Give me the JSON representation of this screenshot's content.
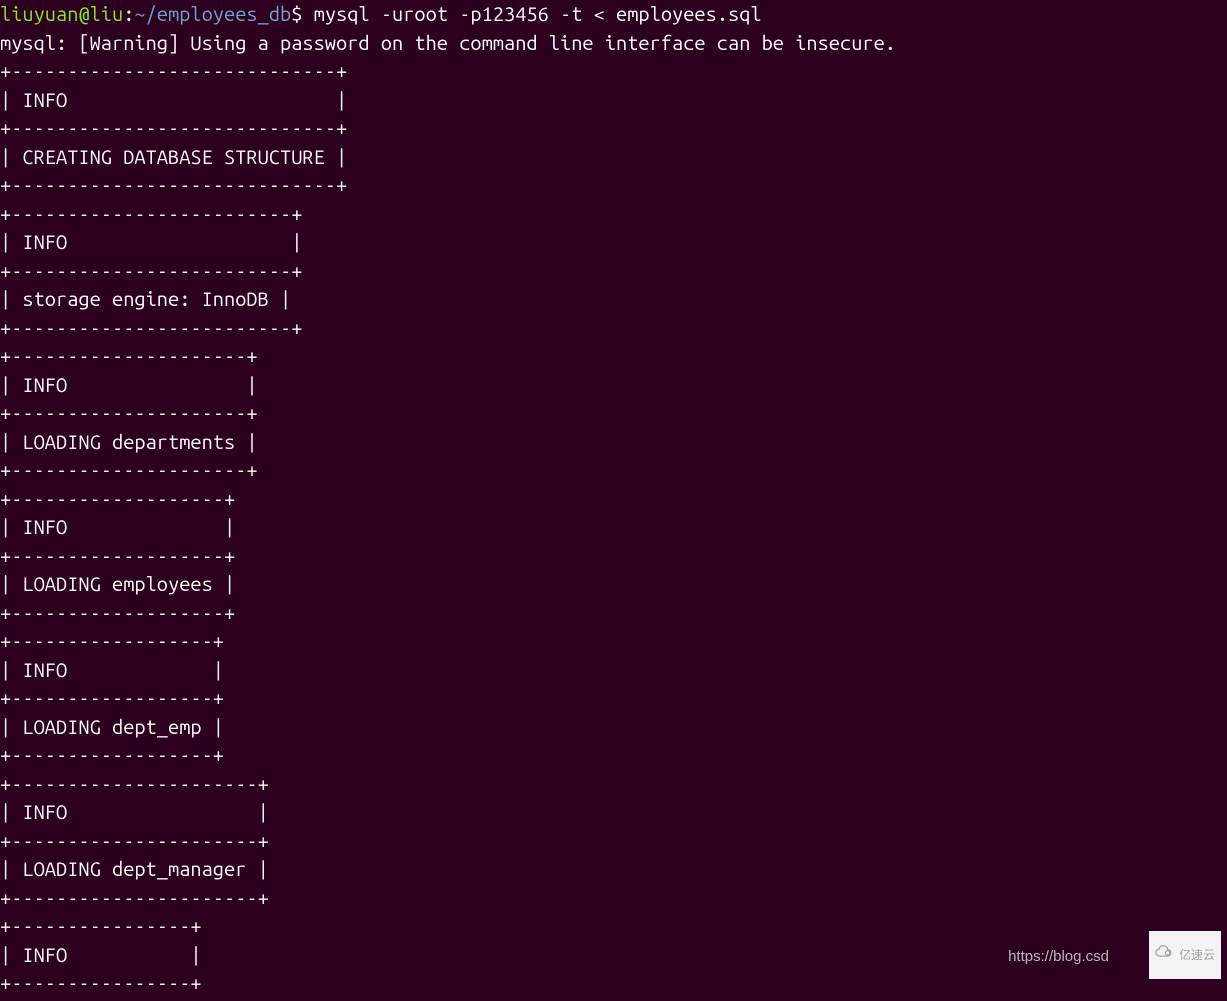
{
  "prompt": {
    "user_host": "liuyuan@liu",
    "separator": ":",
    "path": "~/employees_db",
    "dollar": "$",
    "command": " mysql -uroot -p123456 -t < employees.sql"
  },
  "warning": "mysql: [Warning] Using a password on the command line interface can be insecure.",
  "tables": [
    {
      "border": "+-----------------------------+",
      "header": "| INFO                        |",
      "row": "| CREATING DATABASE STRUCTURE |"
    },
    {
      "border": "+-------------------------+",
      "header": "| INFO                    |",
      "row": "| storage engine: InnoDB |"
    },
    {
      "border": "+---------------------+",
      "header": "| INFO                |",
      "row": "| LOADING departments |"
    },
    {
      "border": "+-------------------+",
      "header": "| INFO              |",
      "row": "| LOADING employees |"
    },
    {
      "border": "+------------------+",
      "header": "| INFO             |",
      "row": "| LOADING dept_emp |"
    },
    {
      "border": "+----------------------+",
      "header": "| INFO                 |",
      "row": "| LOADING dept_manager |"
    },
    {
      "border": "+----------------+",
      "header": "| INFO           |"
    }
  ],
  "watermark_left": "https://blog.csd",
  "watermark_right": "亿速云"
}
